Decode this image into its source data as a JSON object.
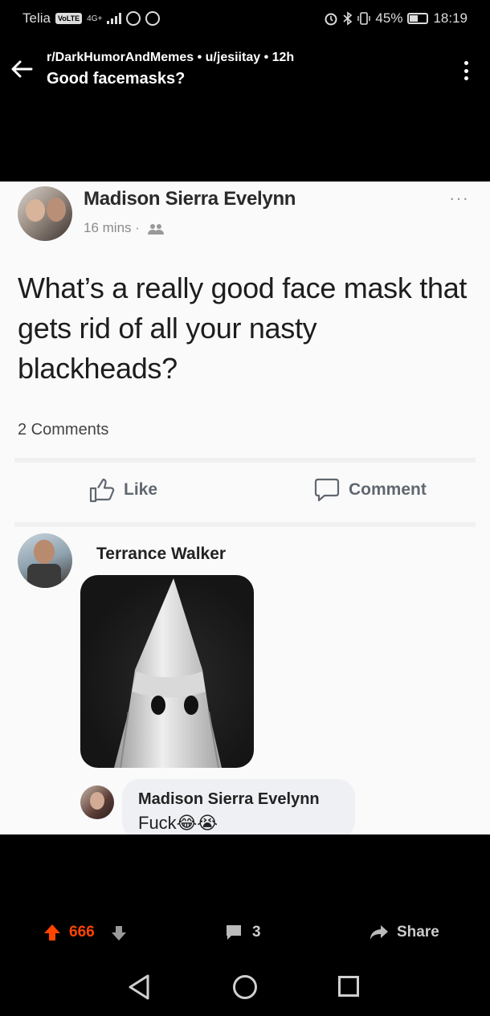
{
  "status_bar": {
    "carrier": "Telia",
    "volte": "VoLTE",
    "network": "4G+",
    "battery": "45%",
    "time": "18:19"
  },
  "header": {
    "meta": "r/DarkHumorAndMemes • u/jesiitay • 12h",
    "title": "Good facemasks?",
    "icons": [
      "back-arrow-icon",
      "more-vertical-icon"
    ]
  },
  "post_image": {
    "author": "Madison Sierra Evelynn",
    "time": "16 mins ·",
    "more": "···",
    "text": "What’s a really good face mask that gets rid of all your nasty blackheads?",
    "comments_count": "2 Comments",
    "like_label": "Like",
    "comment_label": "Comment",
    "comment": {
      "author": "Terrance Walker"
    },
    "reply": {
      "author": "Madison Sierra Evelynn",
      "text": "Fuck😂😭"
    }
  },
  "actions": {
    "score": "666",
    "comments": "3",
    "share": "Share",
    "colors": {
      "upvote": "#ff4500"
    }
  },
  "nav": {
    "icons": [
      "nav-back-icon",
      "nav-home-icon",
      "nav-recents-icon"
    ]
  }
}
